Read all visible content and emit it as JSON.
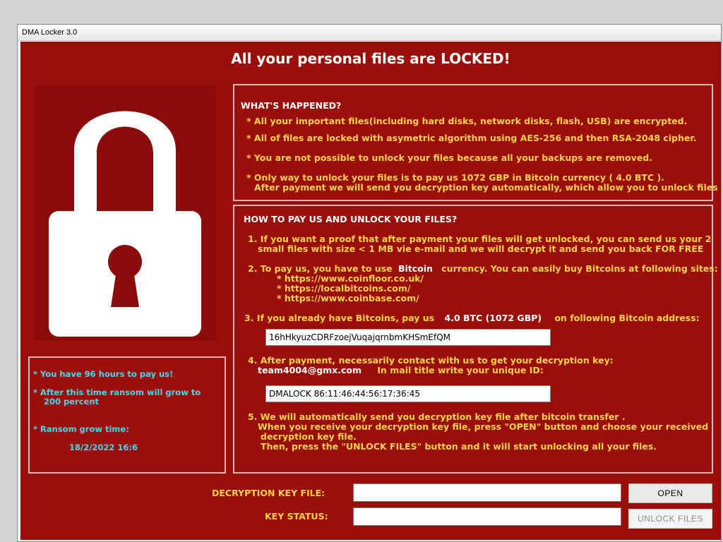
{
  "window": {
    "title": "DMA Locker 3.0"
  },
  "headline": "All your personal files are LOCKED!",
  "lock_icon": "padlock-icon",
  "colors": {
    "background": "#9b0f0a",
    "text_primary": "#ffd24a",
    "text_timer": "#48d6ee",
    "heading": "#ffffff"
  },
  "happened": {
    "title": "WHAT'S HAPPENED?",
    "lines": [
      "*  All your important files(including hard disks, network disks, flash, USB) are encrypted.",
      "*  All of files are locked with asymetric algorithm using AES-256 and then RSA-2048 cipher.",
      "*  You are not possible to unlock your files because all your backups are removed.",
      "*  Only way to unlock your files is to pay us   1072 GBP in Bitcoin currency ( 4.0 BTC ).",
      "After payment we will send you decryption key automatically, which allow you to unlock files ."
    ]
  },
  "howto": {
    "title": "HOW TO PAY US AND UNLOCK YOUR FILES?",
    "step1": [
      "1. If you want a proof that after payment your files will get unlocked, you can send us your 2",
      "small files with size < 1 MB vie e-mail and we will decrypt it and send you back FOR FREE"
    ],
    "step2": {
      "prefix": "2. To pay us, you have to use",
      "currency": "Bitcoin",
      "suffix": "currency. You can easily buy Bitcoins at following sites:",
      "sites": [
        "* https://www.coinfloor.co.uk/",
        "* https://localbitcoins.com/",
        "* https://www.coinbase.com/"
      ]
    },
    "step3": {
      "prefix": "3. If you already have Bitcoins, pay us",
      "amount": "4.0 BTC (1072 GBP)",
      "suffix": "on following Bitcoin address:",
      "address": "16hHkyuzCDRFzoejVuqajqrnbmKHSmEfQM"
    },
    "step4": {
      "line1": "4. After payment, necessarily contact with us to get your decryption key:",
      "email": "team4004@gmx.com",
      "id_prompt": "In mail title write your unique ID:",
      "id_value": "DMALOCK 86:11:46:44:56:17:36:45"
    },
    "step5": [
      "5. We will automatically send you decryption key file after bitcoin transfer .",
      "When you receive your decryption key file, press  \"OPEN\"  button and choose your received",
      "decryption key file.",
      "Then,  press the \"UNLOCK FILES\" button and it will start unlocking all your files."
    ]
  },
  "timer": {
    "line1": "* You have 96 hours to pay us!",
    "line2a": "* After this time ransom will grow to",
    "line2b": "200 percent",
    "line3": "* Ransom grow time:",
    "time": "18/2/2022 16:6"
  },
  "form": {
    "key_file_label": "DECRYPTION KEY FILE:",
    "key_file_value": "",
    "status_label": "KEY STATUS:",
    "status_value": "",
    "open_button": "OPEN",
    "unlock_button": "UNLOCK FILES"
  }
}
